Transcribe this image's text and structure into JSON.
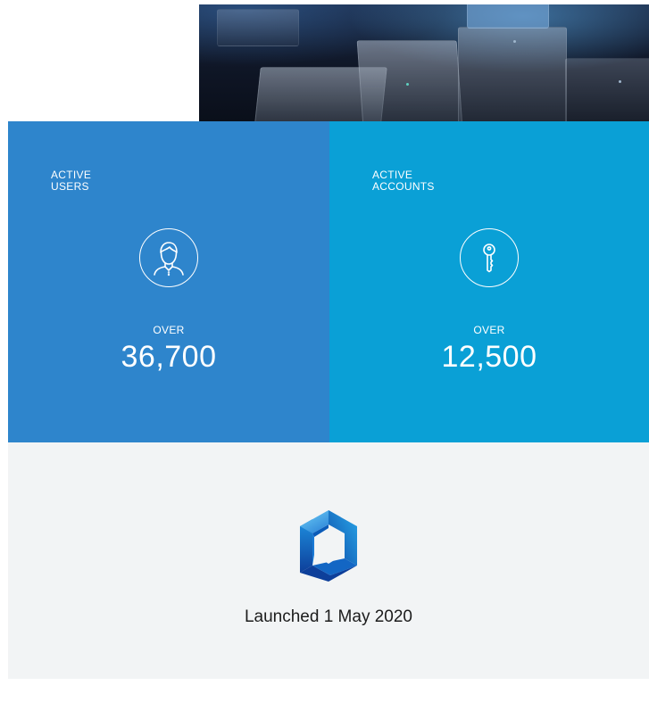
{
  "stats": {
    "users": {
      "label": "ACTIVE USERS",
      "icon": "user-icon",
      "prefix": "OVER",
      "value": "36,700",
      "color": "#2e85cc"
    },
    "accounts": {
      "label": "ACTIVE ACCOUNTS",
      "icon": "key-icon",
      "prefix": "OVER",
      "value": "12,500",
      "color": "#0aa0d6"
    }
  },
  "launch": {
    "logo": "hexagon-logo",
    "caption": "Launched 1 May 2020",
    "background": "#f2f4f5"
  }
}
